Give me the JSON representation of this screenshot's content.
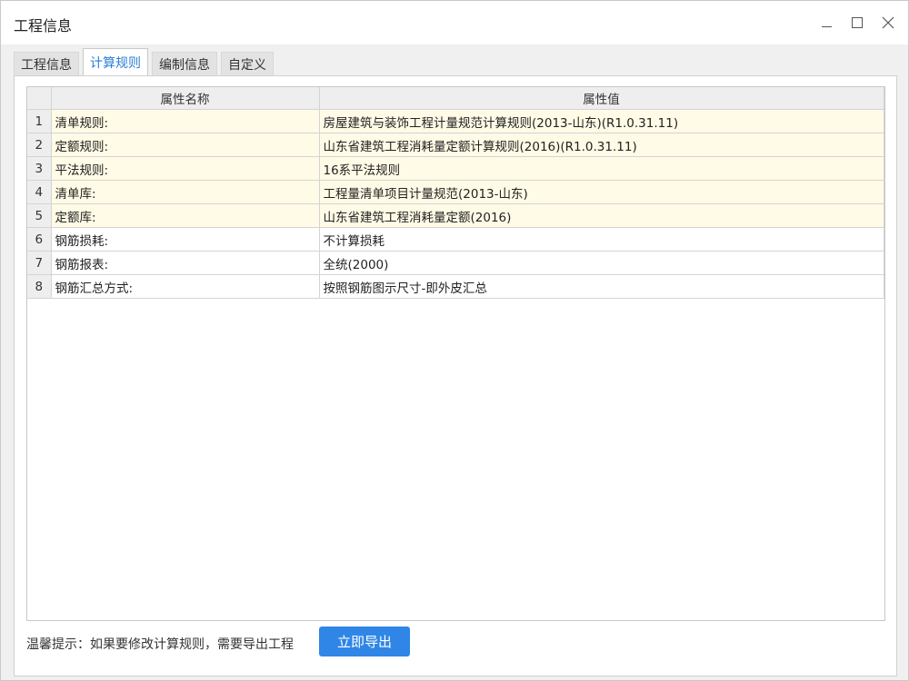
{
  "window": {
    "title": "工程信息",
    "controls": {
      "minimize": "minimize-icon",
      "maximize": "maximize-icon",
      "close": "close-icon"
    }
  },
  "tabs": [
    {
      "label": "工程信息",
      "active": false
    },
    {
      "label": "计算规则",
      "active": true
    },
    {
      "label": "编制信息",
      "active": false
    },
    {
      "label": "自定义",
      "active": false
    }
  ],
  "table": {
    "headers": {
      "name": "属性名称",
      "value": "属性值"
    },
    "rows": [
      {
        "num": "1",
        "name": "清单规则:",
        "value": "房屋建筑与装饰工程计量规范计算规则(2013-山东)(R1.0.31.11)",
        "highlight": true
      },
      {
        "num": "2",
        "name": "定额规则:",
        "value": "山东省建筑工程消耗量定额计算规则(2016)(R1.0.31.11)",
        "highlight": true
      },
      {
        "num": "3",
        "name": "平法规则:",
        "value": "16系平法规则",
        "highlight": true
      },
      {
        "num": "4",
        "name": "清单库:",
        "value": "工程量清单项目计量规范(2013-山东)",
        "highlight": true
      },
      {
        "num": "5",
        "name": "定额库:",
        "value": "山东省建筑工程消耗量定额(2016)",
        "highlight": true
      },
      {
        "num": "6",
        "name": "钢筋损耗:",
        "value": "不计算损耗",
        "highlight": false
      },
      {
        "num": "7",
        "name": "钢筋报表:",
        "value": "全统(2000)",
        "highlight": false
      },
      {
        "num": "8",
        "name": "钢筋汇总方式:",
        "value": "按照钢筋图示尺寸-即外皮汇总",
        "highlight": false
      }
    ]
  },
  "footer": {
    "tip": "温馨提示：如果要修改计算规则，需要导出工程",
    "export_label": "立即导出"
  },
  "colors": {
    "accent": "#2f86e6",
    "highlight_row": "#fffbe6",
    "active_tab_text": "#2a7fd4"
  }
}
